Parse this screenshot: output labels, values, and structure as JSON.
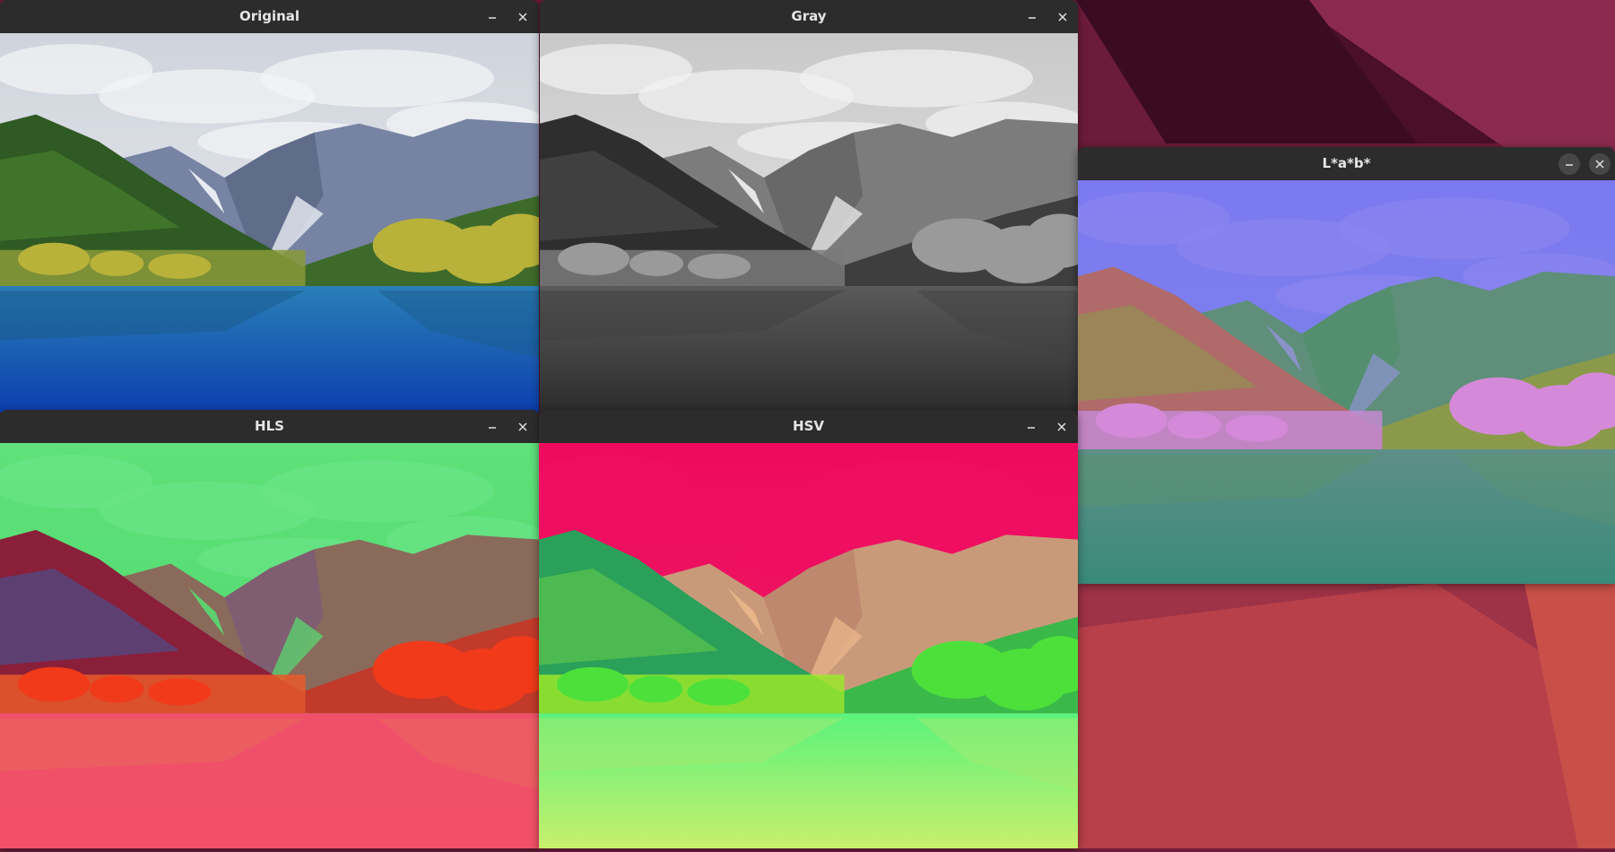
{
  "windows": {
    "original": {
      "title": "Original",
      "colors": {
        "sky_top": "#cfd4dc",
        "sky_bottom": "#eef0f3",
        "cloud": "#f4f5f7",
        "far_mountain": "#7683a3",
        "far_mountain_dark": "#55627f",
        "snow": "#e8ecf2",
        "left_mountain": "#2f5a23",
        "left_mountain_light": "#4f8a33",
        "right_hill": "#3d6a2a",
        "treeline": "#8a9a3a",
        "autumn_trees": "#b9b23a",
        "water_top": "#2a7fb8",
        "water_bottom": "#0d3fae",
        "reflection": "#1a5a8a"
      }
    },
    "gray": {
      "title": "Gray",
      "colors": {
        "sky_top": "#c9c9c9",
        "sky_bottom": "#ececec",
        "cloud": "#f2f2f2",
        "far_mountain": "#7c7c7c",
        "far_mountain_dark": "#5f5f5f",
        "snow": "#e6e6e6",
        "left_mountain": "#2e2e2e",
        "left_mountain_light": "#505050",
        "right_hill": "#3e3e3e",
        "treeline": "#7a7a7a",
        "autumn_trees": "#9a9a9a",
        "water_top": "#5a5a5a",
        "water_bottom": "#2c2c2c",
        "reflection": "#404040"
      }
    },
    "lab": {
      "title": "L*a*b*",
      "colors": {
        "sky_top": "#7b79f0",
        "sky_bottom": "#7d87e8",
        "cloud": "#8a85f0",
        "far_mountain": "#5f8f7a",
        "far_mountain_dark": "#4f8f6a",
        "snow": "#8a92c8",
        "left_mountain": "#b06a6a",
        "left_mountain_light": "#8a9a4a",
        "right_hill": "#8a9a4a",
        "treeline": "#c58ad2",
        "autumn_trees": "#d48ad8",
        "water_top": "#5e8f88",
        "water_bottom": "#3a8a7a",
        "reflection": "#5a9270"
      }
    },
    "hls": {
      "title": "HLS",
      "colors": {
        "sky_top": "#5fe07a",
        "sky_bottom": "#4cd86a",
        "cloud": "#6ae486",
        "far_mountain": "#8a6a5a",
        "far_mountain_dark": "#7a5a7a",
        "snow": "#5ed070",
        "left_mountain": "#8a1f3a",
        "left_mountain_light": "#3a5aa0",
        "right_hill": "#c23a2a",
        "treeline": "#e85a2a",
        "autumn_trees": "#f03a1a",
        "water_top": "#f0506a",
        "water_bottom": "#f25068",
        "reflection": "#e86a5a"
      }
    },
    "hsv": {
      "title": "HSV",
      "colors": {
        "sky_top": "#ee0a5e",
        "sky_bottom": "#ec1f64",
        "cloud": "#f00e62",
        "far_mountain": "#c99a7a",
        "far_mountain_dark": "#b8806a",
        "snow": "#e8b48a",
        "left_mountain": "#2aa05a",
        "left_mountain_light": "#6ad04a",
        "right_hill": "#3ab84a",
        "treeline": "#9ae82a",
        "autumn_trees": "#4ee03a",
        "water_top": "#5af37c",
        "water_bottom": "#c8ef6c",
        "reflection": "#a8e870"
      }
    }
  },
  "desktop": {
    "bg_dark": "#3b0c22",
    "bg_mid": "#7a2244",
    "bg_light": "#c24a4a"
  }
}
